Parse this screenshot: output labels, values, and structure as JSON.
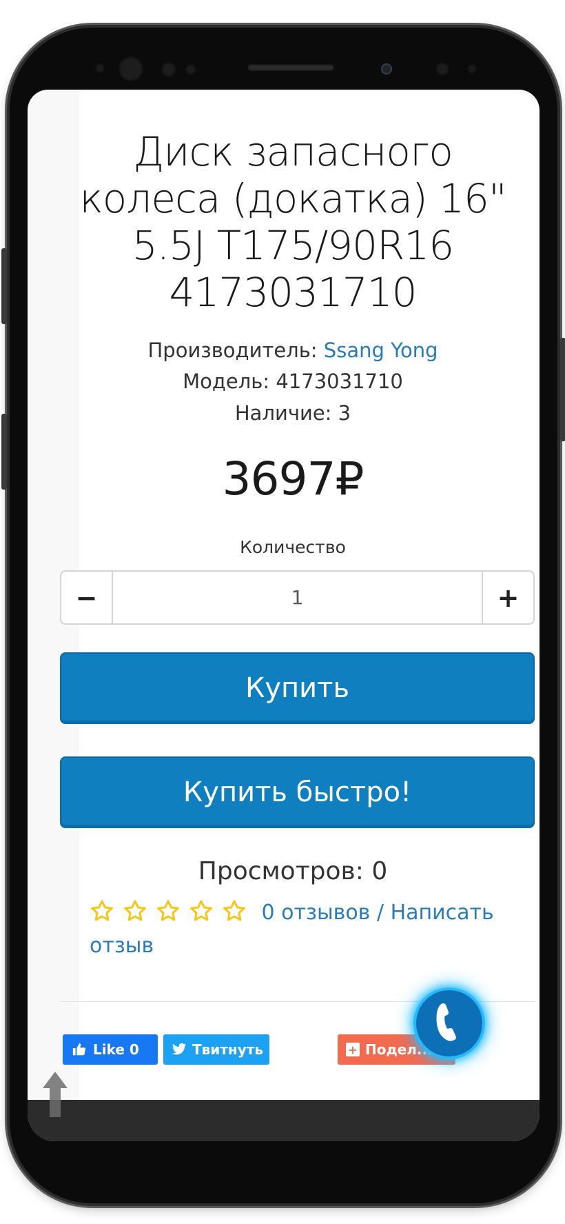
{
  "product": {
    "title_lines": [
      "Диск запасного",
      "колеса (докатка) 16\"",
      "5.5J T175/90R16",
      "4173031710"
    ],
    "manufacturer_label": "Производитель:",
    "manufacturer_value": "Ssang Yong",
    "model_label": "Модель:",
    "model_value": "4173031710",
    "stock_label": "Наличие:",
    "stock_value": "3",
    "price": "3697₽"
  },
  "quantity": {
    "label": "Количество",
    "minus": "−",
    "plus": "+",
    "value": "1"
  },
  "buttons": {
    "buy": "Купить",
    "buy_fast": "Купить быстро!"
  },
  "views_text": "Просмотров: 0",
  "rating": {
    "stars_filled": 0,
    "stars_total": 5,
    "reviews_link": "0 отзывов",
    "separator": "/",
    "write_review_link": "Написать отзыв"
  },
  "social": {
    "like_label": "Like 0",
    "tweet_label": "Твитнуть",
    "share_label": "Подел..."
  },
  "icons": {
    "phone": "phone-icon",
    "facebook": "facebook-like-icon",
    "twitter": "twitter-icon",
    "share": "share-icon",
    "scroll_top": "arrow-up-icon",
    "star": "star-outline-icon"
  },
  "colors": {
    "accent": "#0f7fbf",
    "link": "#2a7ab6",
    "star": "#f5c518",
    "call_glow": "#26b9ff"
  }
}
